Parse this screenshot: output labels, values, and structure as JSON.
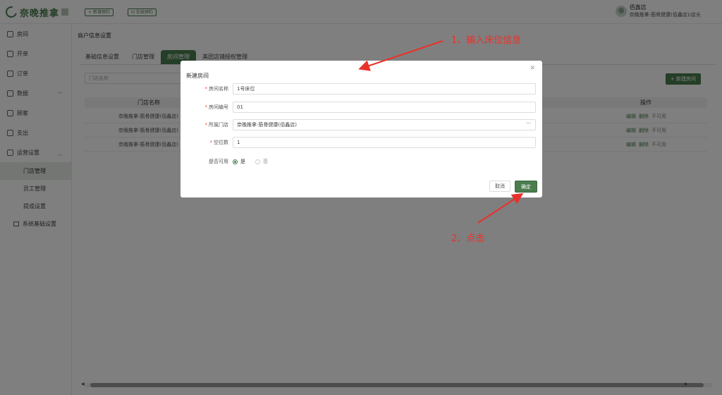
{
  "app": {
    "brand": "奈晚推拿"
  },
  "header": {
    "btn1": "+ 新增预约",
    "btn2": "⊡ 在线预约",
    "user_name": "佰鑫店",
    "user_sub": "奈晚推拿-筋骨健康(佰鑫店)/店长"
  },
  "sidebar": {
    "items": [
      {
        "label": "房间",
        "icon": "home-icon"
      },
      {
        "label": "开单",
        "icon": "file-icon"
      },
      {
        "label": "订单",
        "icon": "order-icon"
      },
      {
        "label": "数据",
        "icon": "data-icon"
      },
      {
        "label": "顾客",
        "icon": "user-icon"
      },
      {
        "label": "支出",
        "icon": "wallet-icon"
      },
      {
        "label": "运营设置",
        "icon": "settings-icon"
      }
    ],
    "sub_items": [
      {
        "label": "门店管理",
        "active": true
      },
      {
        "label": "员工管理"
      },
      {
        "label": "提成设置"
      }
    ],
    "extra_item": "系统基础设置"
  },
  "main": {
    "title": "商户信息设置",
    "tabs": [
      "基础信息设置",
      "门店管理",
      "房间管理",
      "美团店铺授权管理"
    ],
    "active_tab": "房间管理",
    "search_placeholder": "门店名称",
    "new_button": "+ 新建房间",
    "table": {
      "headers": {
        "store": "门店名称",
        "ops": "操作"
      },
      "rows": [
        {
          "store": "奈晚推拿-筋骨健康(佰鑫店)",
          "ops": [
            "编辑",
            "删除",
            "不可用"
          ]
        },
        {
          "store": "奈晚推拿-筋骨健康(佰鑫店)",
          "ops": [
            "编辑",
            "删除",
            "不可用"
          ]
        },
        {
          "store": "奈晚推拿-筋骨健康(佰鑫店)",
          "ops": [
            "编辑",
            "删除",
            "不可用"
          ]
        }
      ]
    }
  },
  "modal": {
    "title": "新建房间",
    "fields": {
      "room_name": {
        "label": "房间名称",
        "value": "1号床位",
        "required": true
      },
      "room_no": {
        "label": "房间编号",
        "value": "01",
        "required": true
      },
      "store": {
        "label": "所属门店",
        "value": "奈晚推拿-筋骨健康(佰鑫店)",
        "required": true
      },
      "slots": {
        "label": "空位数",
        "value": "1",
        "required": true
      },
      "available": {
        "label": "是否可用",
        "options": [
          "是",
          "否"
        ],
        "selected": "是"
      }
    },
    "cancel": "取消",
    "ok": "确定"
  },
  "annotations": {
    "step1": "1、输入床位信息",
    "step2": "2、点击"
  },
  "colors": {
    "brand": "#4a7c4e",
    "annotation": "#e8322b"
  }
}
